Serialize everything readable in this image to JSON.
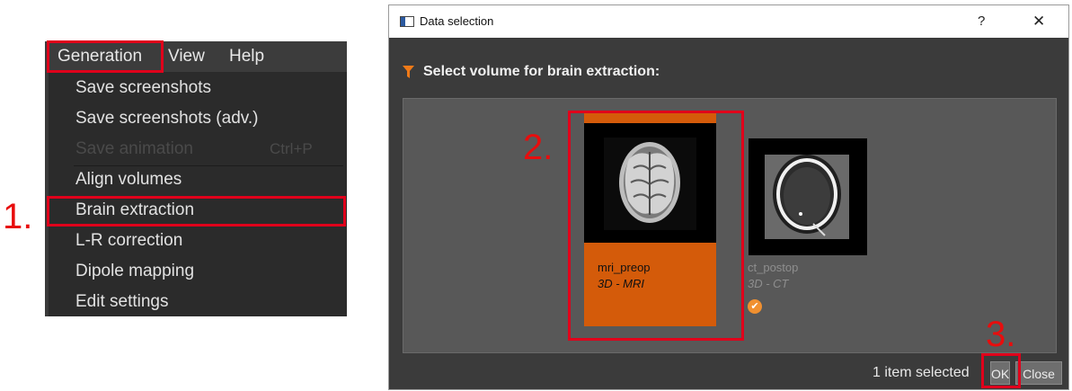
{
  "menubar": {
    "items": [
      "Generation",
      "View",
      "Help"
    ]
  },
  "dropdown": {
    "items": [
      {
        "label": "Save screenshots",
        "enabled": true
      },
      {
        "label": "Save screenshots (adv.)",
        "enabled": true
      },
      {
        "label": "Save animation",
        "enabled": false,
        "shortcut": "Ctrl+P"
      },
      {
        "label": "Align volumes",
        "enabled": true
      },
      {
        "label": "Brain extraction",
        "enabled": true
      },
      {
        "label": "L-R correction",
        "enabled": true
      },
      {
        "label": "Dipole mapping",
        "enabled": true
      },
      {
        "label": "Edit settings",
        "enabled": true
      }
    ]
  },
  "steps": [
    "1.",
    "2.",
    "3."
  ],
  "dialog": {
    "title": "Data selection",
    "help_button": "?",
    "close_button": "✕",
    "header": "Select volume for brain extraction:",
    "volumes": [
      {
        "name": "mri_preop",
        "meta": "3D - MRI",
        "selected": true
      },
      {
        "name": "ct_postop",
        "meta": "3D - CT",
        "selected": false,
        "check": "✔"
      }
    ],
    "status": "1 item selected",
    "ok_button": "OK",
    "cancel_button": "Close"
  },
  "colors": {
    "highlight_red": "#e0001b",
    "selection_orange": "#d45b0a",
    "dark_bg": "#3b3b3b"
  }
}
